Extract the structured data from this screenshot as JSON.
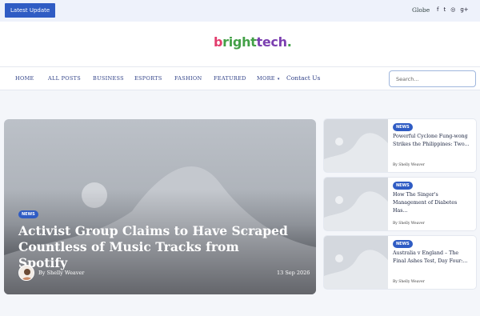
{
  "topbar": {
    "latest_label": "Latest Update",
    "region": "Globe",
    "socials": [
      {
        "icon": "facebook-icon",
        "glyph": "f"
      },
      {
        "icon": "twitter-icon",
        "glyph": "t"
      },
      {
        "icon": "instagram-icon",
        "glyph": "◎"
      },
      {
        "icon": "google-plus-icon",
        "glyph": "g+"
      }
    ]
  },
  "logo": {
    "part1": "b",
    "part2": "right",
    "part3": "tech",
    "dot": "."
  },
  "nav": {
    "items": [
      "HOME",
      "ALL POSTS",
      "BUSINESS",
      "ESPORTS",
      "FASHION",
      "FEATURED",
      "MORE"
    ],
    "more_caret": "▾",
    "contact": "Contact Us",
    "search_placeholder": "Search..."
  },
  "featured": {
    "badge": "NEWS",
    "title": "Activist Group Claims to Have Scraped Countless of Music Tracks from Spotify",
    "author_prefix": "By",
    "author": "Shelly Weaver",
    "date": "13 Sep 2026"
  },
  "side_posts": [
    {
      "badge": "NEWS",
      "title": "Powerful Cyclone Fung-wong Strikes the Philippines: Two...",
      "by": "By",
      "author": "Shelly Weaver"
    },
    {
      "badge": "NEWS",
      "title": "How The Singer's Management of Diabetes Has...",
      "by": "By",
      "author": "Shelly Weaver"
    },
    {
      "badge": "NEWS",
      "title": "Australia v England – The Final Ashes Test, Day Four:...",
      "by": "By",
      "author": "Shelly Weaver"
    }
  ],
  "colors": {
    "accent": "#2f5cc4",
    "nav_text": "#2e3f86"
  }
}
